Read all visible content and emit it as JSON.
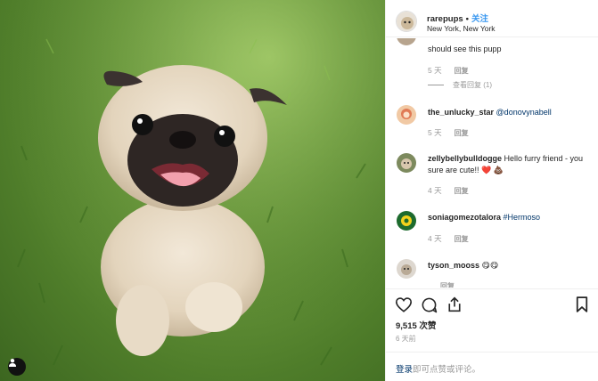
{
  "post": {
    "username": "rarepups",
    "separator": "•",
    "follow_label": "关注",
    "location": "New York, New York"
  },
  "comments": [
    {
      "text": "should see this pupp",
      "age": "5 天",
      "reply": "回复",
      "view_replies": "查看回复 (1)"
    },
    {
      "user": "the_unlucky_star",
      "mention": "@donovynabell",
      "age": "5 天",
      "reply": "回复"
    },
    {
      "user": "zellybellybulldogge",
      "text": "Hello furry friend - you sure are cute!! ❤️ 💩",
      "age": "4 天",
      "reply": "回复"
    },
    {
      "user": "soniagomezotalora",
      "mention": "#Hermoso",
      "age": "4 天",
      "reply": "回复"
    },
    {
      "user": "tyson_mooss",
      "text": "😋😋",
      "age": "",
      "reply": "回复"
    }
  ],
  "actions": {
    "icons": [
      "heart-icon",
      "comment-icon",
      "share-icon",
      "bookmark-icon"
    ],
    "likes": "9,515 次赞",
    "time": "6 天前"
  },
  "login": {
    "link": "登录",
    "rest": "即可点赞或评论。"
  },
  "colors": {
    "link": "#003569",
    "follow": "#3897f0",
    "muted": "#999999"
  }
}
